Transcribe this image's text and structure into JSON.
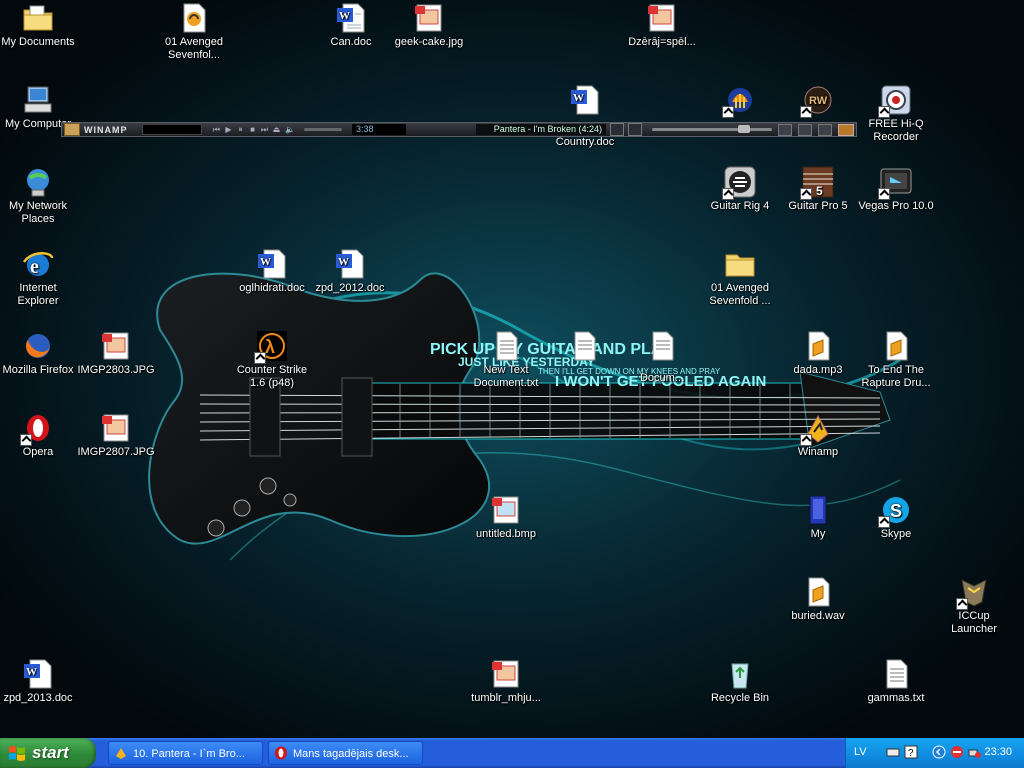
{
  "desktop": {
    "wallpaper_text": {
      "line1": "PICK UP MY GUITAR AND PLAY",
      "line2": "JUST LIKE YESTERDAY",
      "line3": "THEN I'LL GET DOWN ON MY KNEES AND PRAY",
      "line4": "I WON'T GET FOOLED AGAIN"
    },
    "icons": [
      {
        "id": "my-documents",
        "label": "My Documents",
        "icon": "folder-docs-icon"
      },
      {
        "id": "avenged-1",
        "label": "01 Avenged Sevenfol...",
        "icon": "audio-file-icon"
      },
      {
        "id": "can-doc",
        "label": "Can.doc",
        "icon": "word-doc-icon"
      },
      {
        "id": "geek-cake",
        "label": "geek-cake.jpg",
        "icon": "image-file-icon"
      },
      {
        "id": "dzeraj",
        "label": "Dzērāj=spēl...",
        "icon": "image-file-icon"
      },
      {
        "id": "my-computer",
        "label": "My Computer",
        "icon": "computer-icon"
      },
      {
        "id": "country-doc",
        "label": "Country.doc",
        "icon": "word-doc-icon"
      },
      {
        "id": "audacity",
        "label": "",
        "icon": "audacity-icon"
      },
      {
        "id": "rw",
        "label": "",
        "icon": "rw-icon"
      },
      {
        "id": "hiq",
        "label": "FREE Hi-Q Recorder",
        "icon": "recorder-icon"
      },
      {
        "id": "network",
        "label": "My Network Places",
        "icon": "network-icon"
      },
      {
        "id": "guitar-rig",
        "label": "Guitar Rig 4",
        "icon": "guitar-rig-icon"
      },
      {
        "id": "guitar-pro",
        "label": "Guitar Pro 5",
        "icon": "guitar-pro-icon"
      },
      {
        "id": "vegas",
        "label": "Vegas Pro 10.0",
        "icon": "vegas-icon"
      },
      {
        "id": "ie",
        "label": "Internet Explorer",
        "icon": "ie-icon"
      },
      {
        "id": "oglhidrati",
        "label": "oglhidrati.doc",
        "icon": "word-doc-icon"
      },
      {
        "id": "zpd2012",
        "label": "zpd_2012.doc",
        "icon": "word-doc-icon"
      },
      {
        "id": "avenged-folder",
        "label": "01 Avenged Sevenfold ...",
        "icon": "folder-icon"
      },
      {
        "id": "firefox",
        "label": "Mozilla Firefox",
        "icon": "firefox-icon"
      },
      {
        "id": "img2803",
        "label": "IMGP2803.JPG",
        "icon": "image-file-icon"
      },
      {
        "id": "cs",
        "label": "Counter Strike 1.6 (p48)",
        "icon": "half-life-icon"
      },
      {
        "id": "newtext",
        "label": "New Text Document.txt",
        "icon": "text-file-icon"
      },
      {
        "id": "newtext2",
        "label": "",
        "icon": "text-file-icon"
      },
      {
        "id": "newtext3",
        "label": "Docum...",
        "icon": "text-file-icon"
      },
      {
        "id": "dada",
        "label": "dada.mp3",
        "icon": "audio-file-icon"
      },
      {
        "id": "toend",
        "label": "To End The Rapture Dru...",
        "icon": "audio-file-icon"
      },
      {
        "id": "opera",
        "label": "Opera",
        "icon": "opera-icon"
      },
      {
        "id": "img2807",
        "label": "IMGP2807.JPG",
        "icon": "image-file-icon"
      },
      {
        "id": "winamp",
        "label": "Winamp",
        "icon": "winamp-icon"
      },
      {
        "id": "untitled",
        "label": "untitled.bmp",
        "icon": "image-file-icon"
      },
      {
        "id": "my",
        "label": "My",
        "icon": "book-icon"
      },
      {
        "id": "skype",
        "label": "Skype",
        "icon": "skype-icon"
      },
      {
        "id": "buried",
        "label": "buried.wav",
        "icon": "audio-file-icon"
      },
      {
        "id": "iccup",
        "label": "ICCup Launcher",
        "icon": "iccup-icon"
      },
      {
        "id": "zpd2013",
        "label": "zpd_2013.doc",
        "icon": "word-doc-icon"
      },
      {
        "id": "tumblr",
        "label": "tumblr_mhju...",
        "icon": "image-file-icon"
      },
      {
        "id": "recycle",
        "label": "Recycle Bin",
        "icon": "recycle-bin-icon"
      },
      {
        "id": "gammas",
        "label": "gammas.txt",
        "icon": "text-file-icon"
      }
    ]
  },
  "winamp": {
    "name": "WINAMP",
    "time": "3:38",
    "track": "Pantera - I'm Broken (4:24)"
  },
  "taskbar": {
    "start_label": "start",
    "tasks": [
      {
        "label": "10. Pantera - I`m Bro...",
        "icon": "winamp-icon"
      },
      {
        "label": "Mans tagadējais desk...",
        "icon": "opera-icon"
      }
    ],
    "tray": {
      "language": "LV",
      "clock": "23:30"
    }
  },
  "colors": {
    "taskbar_blue": "#245edb",
    "start_green": "#3a9a44",
    "tray_blue": "#0f8be0",
    "wallpaper_glow": "#1fd3d8"
  }
}
